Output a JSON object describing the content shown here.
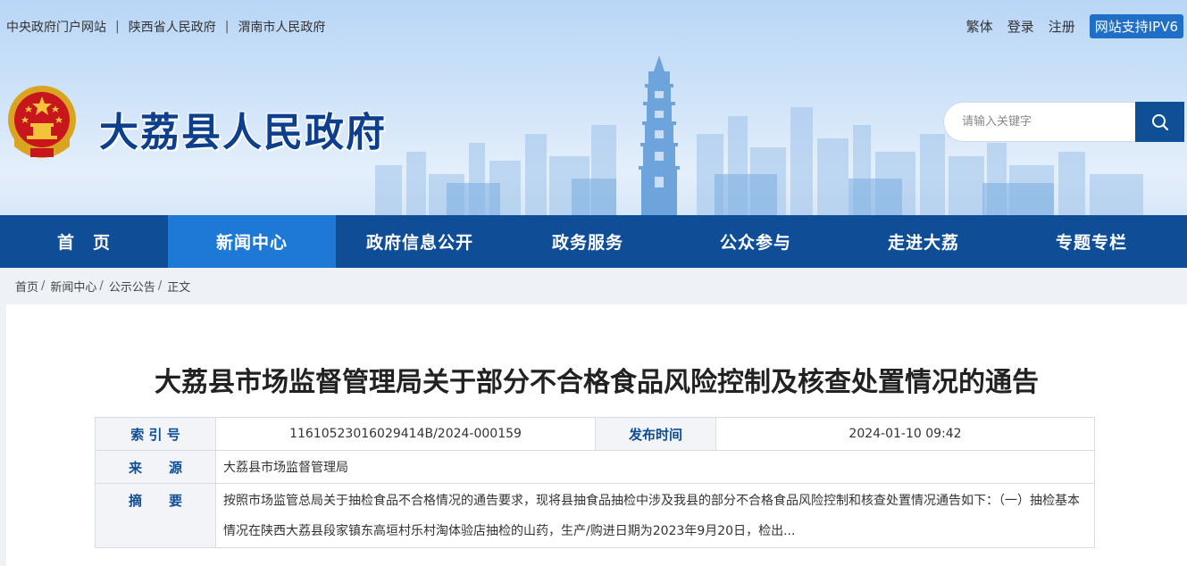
{
  "top_links": [
    "中央政府门户网站",
    "陕西省人民政府",
    "渭南市人民政府"
  ],
  "top_right": {
    "traditional": "繁体",
    "login": "登录",
    "register": "注册",
    "ipv6": "网站支持IPV6"
  },
  "site_name": "大荔县人民政府",
  "search": {
    "placeholder": "请输入关键字"
  },
  "nav": [
    "首　页",
    "新闻中心",
    "政府信息公开",
    "政务服务",
    "公众参与",
    "走进大荔",
    "专题专栏"
  ],
  "nav_active_index": 1,
  "breadcrumb": [
    "首页",
    "新闻中心",
    "公示公告",
    "正文"
  ],
  "article": {
    "title": "大荔县市场监督管理局关于部分不合格食品风险控制及核查处置情况的通告",
    "index_label": "索 引 号",
    "index_value": "11610523016029414B/2024-000159",
    "date_label": "发布时间",
    "date_value": "2024-01-10 09:42",
    "source_label": "来　　源",
    "source_value": "大荔县市场监督管理局",
    "abstract_label": "摘　　要",
    "abstract_value": "按照市场监管总局关于抽检食品不合格情况的通告要求，现将县抽食品抽检中涉及我县的部分不合格食品风险控制和核查处置情况通告如下：（一）抽检基本情况在陕西大荔县段家镇东高垣村乐村淘体验店抽检的山药，生产/购进日期为2023年9月20日，检出..."
  },
  "colors": {
    "nav": "#0f4d96",
    "nav_active": "#1e78d6",
    "brand_text": "#0d3f8c",
    "ipv6": "#1f6fc7"
  },
  "icons": {
    "search": "search-icon",
    "emblem": "national-emblem-icon"
  }
}
